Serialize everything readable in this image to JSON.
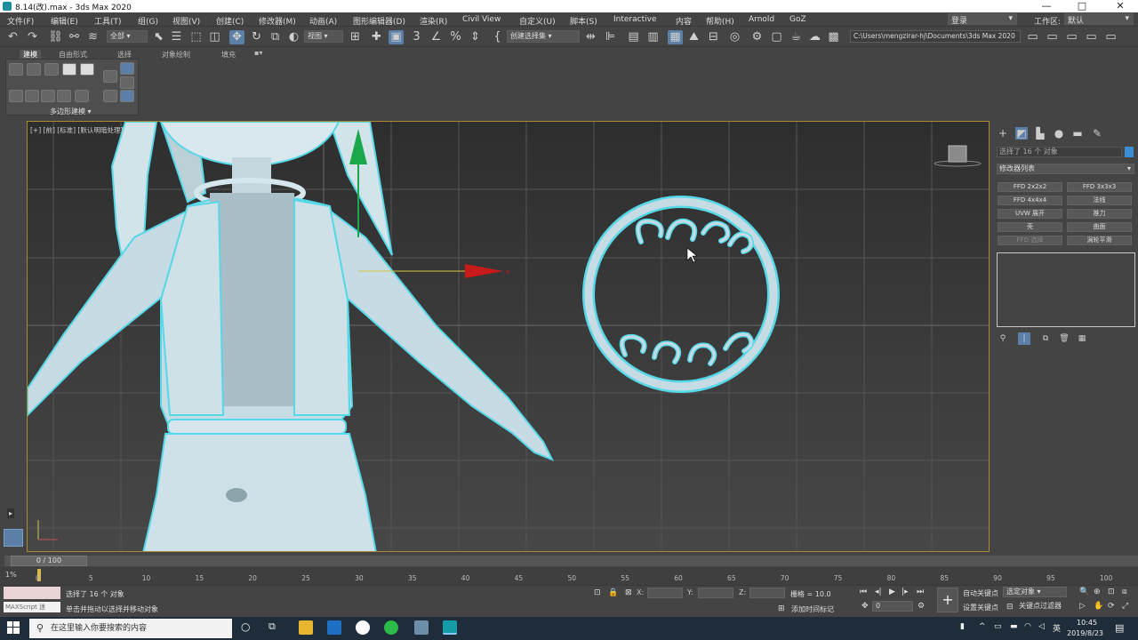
{
  "window": {
    "title": "8.14(改).max - 3ds Max 2020",
    "controls": [
      "—",
      "□",
      "✕"
    ]
  },
  "menu": {
    "items": [
      "文件(F)",
      "编辑(E)",
      "工具(T)",
      "组(G)",
      "视图(V)",
      "创建(C)",
      "修改器(M)",
      "动画(A)",
      "图形编辑器(D)",
      "渲染(R)",
      "Civil View",
      "自定义(U)",
      "脚本(S)",
      "Interactive",
      "内容",
      "帮助(H)",
      "Arnold",
      "GoZ"
    ],
    "login": "登录",
    "workspace_label": "工作区:",
    "workspace_value": "默认"
  },
  "toolbar": {
    "filter": "全部",
    "ref_coord": "视图",
    "selection_set": "创建选择集",
    "project_path": "C:\\Users\\mengzirar-hj\\Documents\\3ds Max 2020"
  },
  "ribbon": {
    "tabs": [
      "建模",
      "自由形式",
      "选择",
      "对象绘制",
      "填充"
    ],
    "panel_label": "多边形建模"
  },
  "viewport": {
    "label": "[+] [前] [标准] [默认明暗处理]"
  },
  "command_panel": {
    "selection_text": "选择了 16 个 对象",
    "modifier_list": "修改器列表",
    "modifiers": [
      {
        "label": "FFD 2x2x2",
        "dim": false
      },
      {
        "label": "FFD 3x3x3",
        "dim": false
      },
      {
        "label": "FFD 4x4x4",
        "dim": false
      },
      {
        "label": "法线",
        "dim": false
      },
      {
        "label": "UVW 展开",
        "dim": false
      },
      {
        "label": "推力",
        "dim": false
      },
      {
        "label": "壳",
        "dim": false
      },
      {
        "label": "曲面",
        "dim": false
      },
      {
        "label": "FFD 选择",
        "dim": true
      },
      {
        "label": "涡轮平滑",
        "dim": false
      }
    ]
  },
  "timeline": {
    "frame_display": "0 / 100",
    "ticks": [
      "0",
      "5",
      "10",
      "15",
      "20",
      "25",
      "30",
      "35",
      "40",
      "45",
      "50",
      "55",
      "60",
      "65",
      "70",
      "75",
      "80",
      "85",
      "90",
      "95",
      "100"
    ],
    "zoom": "1%"
  },
  "status": {
    "maxscript": "MAXScript 迷",
    "selected": "选择了 16 个 对象",
    "prompt": "单击并拖动以选择并移动对象",
    "x_label": "X:",
    "y_label": "Y:",
    "z_label": "Z:",
    "grid": "栅格 = 10.0",
    "add_time_tag": "添加时间标记",
    "auto_key": "自动关键点",
    "set_key": "设置关键点",
    "selected_object": "选定对象",
    "key_filters": "关键点过滤器",
    "frame_field": "0"
  },
  "taskbar": {
    "search_placeholder": "在这里输入你要搜索的内容",
    "ime": "英",
    "time": "10:45",
    "date": "2019/8/23"
  },
  "colors": {
    "accent_blue": "#5b7fa6",
    "viewport_border": "#a88a33",
    "selection_cyan": "#55d8e8",
    "gizmo_red": "#c81a1a",
    "gizmo_green": "#1aa84a"
  }
}
